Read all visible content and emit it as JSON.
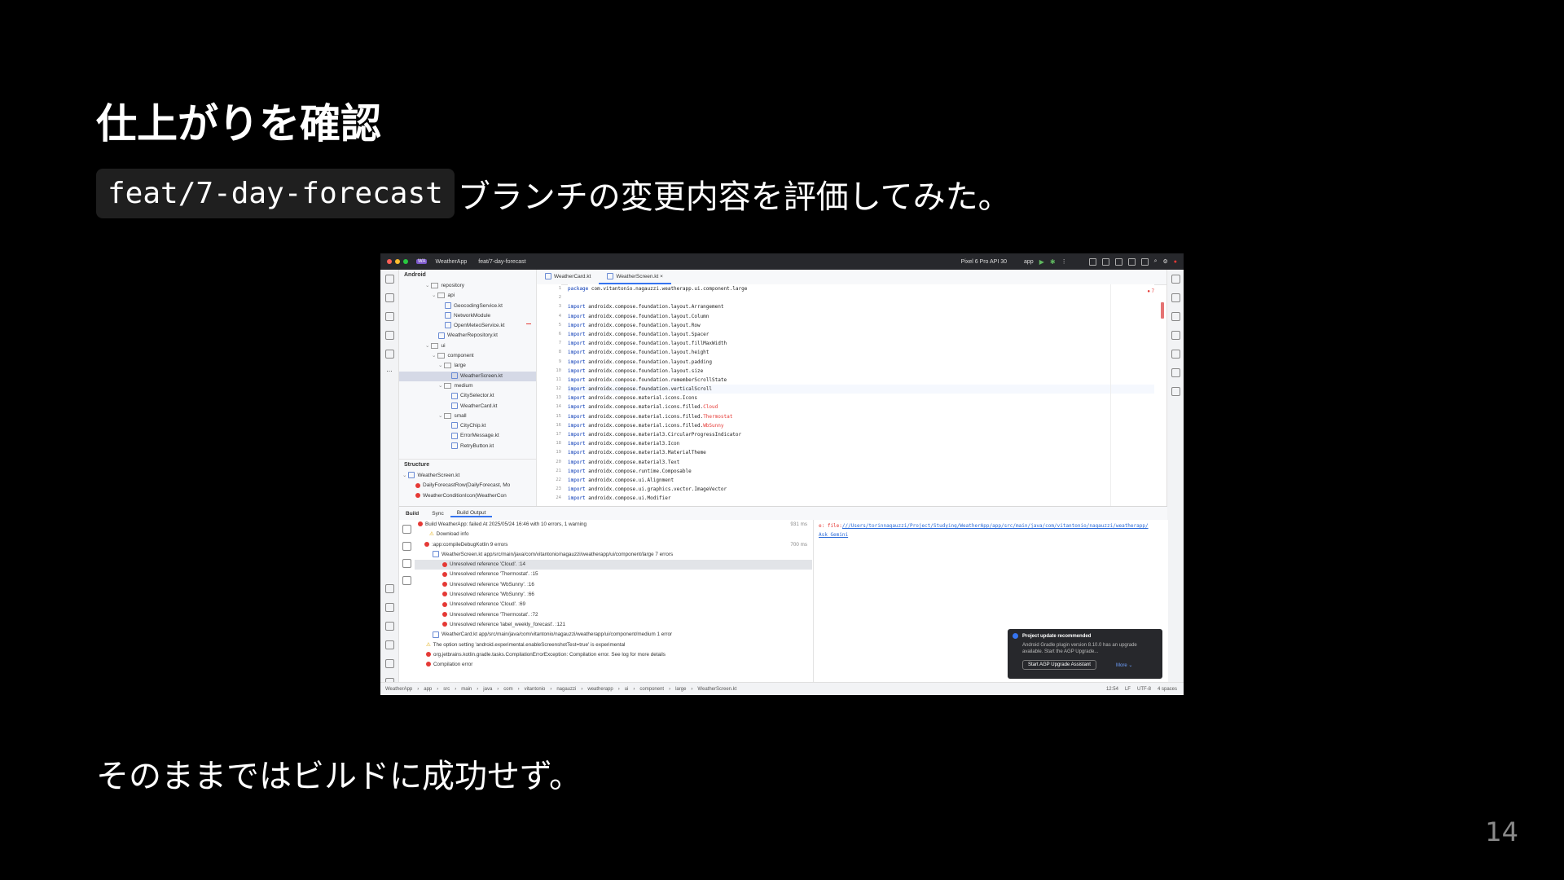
{
  "slide": {
    "title": "仕上がりを確認",
    "branch": "feat/7-day-forecast",
    "subtitle_rest": "ブランチの変更内容を評価してみた。",
    "bottom_text": "そのままではビルドに成功せず。",
    "page_number": "14"
  },
  "ide": {
    "titlebar": {
      "project_badge": "WA",
      "project": "WeatherApp",
      "branch": "feat/7-day-forecast",
      "device": "Pixel 6 Pro API 30",
      "run_config": "app"
    },
    "project_panel": {
      "header": "Android",
      "items": [
        {
          "label": "repository",
          "type": "folder"
        },
        {
          "label": "api",
          "type": "folder"
        },
        {
          "label": "GeocodingService.kt",
          "type": "file"
        },
        {
          "label": "NetworkModule",
          "type": "file"
        },
        {
          "label": "OpenMeteoService.kt",
          "type": "file"
        },
        {
          "label": "WeatherRepository.kt",
          "type": "file"
        },
        {
          "label": "ui",
          "type": "folder"
        },
        {
          "label": "component",
          "type": "folder"
        },
        {
          "label": "large",
          "type": "folder"
        },
        {
          "label": "WeatherScreen.kt",
          "type": "file"
        },
        {
          "label": "medium",
          "type": "folder"
        },
        {
          "label": "CitySelector.kt",
          "type": "file"
        },
        {
          "label": "WeatherCard.kt",
          "type": "file"
        },
        {
          "label": "small",
          "type": "folder"
        },
        {
          "label": "CityChip.kt",
          "type": "file"
        },
        {
          "label": "ErrorMessage.kt",
          "type": "file"
        },
        {
          "label": "RetryButton.kt",
          "type": "file"
        }
      ]
    },
    "structure": {
      "header": "Structure",
      "items": [
        "WeatherScreen.kt",
        "DailyForecastRow(DailyForecast, Mo",
        "WeatherConditionIcon(WeatherCon"
      ]
    },
    "editor": {
      "tabs": [
        "WeatherCard.kt",
        "WeatherScreen.kt"
      ],
      "error_count": "7",
      "lines": [
        {
          "n": "1",
          "kw": "package",
          "rest": " com.vitantonio.nagauzzi.weatherapp.ui.component.large"
        },
        {
          "n": "2",
          "kw": "",
          "rest": ""
        },
        {
          "n": "3",
          "kw": "import",
          "rest": " androidx.compose.foundation.layout.Arrangement"
        },
        {
          "n": "4",
          "kw": "import",
          "rest": " androidx.compose.foundation.layout.Column"
        },
        {
          "n": "5",
          "kw": "import",
          "rest": " androidx.compose.foundation.layout.Row"
        },
        {
          "n": "6",
          "kw": "import",
          "rest": " androidx.compose.foundation.layout.Spacer"
        },
        {
          "n": "7",
          "kw": "import",
          "rest": " androidx.compose.foundation.layout.fillMaxWidth"
        },
        {
          "n": "8",
          "kw": "import",
          "rest": " androidx.compose.foundation.layout.height"
        },
        {
          "n": "9",
          "kw": "import",
          "rest": " androidx.compose.foundation.layout.padding"
        },
        {
          "n": "10",
          "kw": "import",
          "rest": " androidx.compose.foundation.layout.size"
        },
        {
          "n": "11",
          "kw": "import",
          "rest": " androidx.compose.foundation.rememberScrollState"
        },
        {
          "n": "12",
          "kw": "import",
          "rest": " androidx.compose.foundation.verticalScroll"
        },
        {
          "n": "13",
          "kw": "import",
          "rest": " androidx.compose.material.icons.Icons"
        },
        {
          "n": "14",
          "kw": "import",
          "rest": " androidx.compose.material.icons.filled.",
          "err": "Cloud"
        },
        {
          "n": "15",
          "kw": "import",
          "rest": " androidx.compose.material.icons.filled.",
          "err": "Thermostat"
        },
        {
          "n": "16",
          "kw": "import",
          "rest": " androidx.compose.material.icons.filled.",
          "err": "WbSunny"
        },
        {
          "n": "17",
          "kw": "import",
          "rest": " androidx.compose.material3.CircularProgressIndicator"
        },
        {
          "n": "18",
          "kw": "import",
          "rest": " androidx.compose.material3.Icon"
        },
        {
          "n": "19",
          "kw": "import",
          "rest": " androidx.compose.material3.MaterialTheme"
        },
        {
          "n": "20",
          "kw": "import",
          "rest": " androidx.compose.material3.Text"
        },
        {
          "n": "21",
          "kw": "import",
          "rest": " androidx.compose.runtime.Composable"
        },
        {
          "n": "22",
          "kw": "import",
          "rest": " androidx.compose.ui.Alignment"
        },
        {
          "n": "23",
          "kw": "import",
          "rest": " androidx.compose.ui.graphics.vector.ImageVector"
        },
        {
          "n": "24",
          "kw": "import",
          "rest": " androidx.compose.ui.Modifier"
        }
      ]
    },
    "bottom_tabs": [
      "Build",
      "Sync",
      "Build Output"
    ],
    "build_tree": [
      {
        "text": "Build WeatherApp: failed At 2025/05/24 16:46 with 10 errors, 1 warning",
        "icon": "error",
        "time": "931 ms"
      },
      {
        "text": "Download info",
        "icon": "warning",
        "time": ""
      },
      {
        "text": ":app:compileDebugKotlin 9 errors",
        "icon": "error",
        "time": "700 ms"
      },
      {
        "text": "WeatherScreen.kt app/src/main/java/com/vitantonio/nagauzzi/weatherapp/ui/component/large 7 errors",
        "icon": "file",
        "time": ""
      },
      {
        "text": "Unresolved reference 'Cloud'. :14",
        "icon": "error",
        "time": ""
      },
      {
        "text": "Unresolved reference 'Thermostat'. :15",
        "icon": "error",
        "time": ""
      },
      {
        "text": "Unresolved reference 'WbSunny'. :16",
        "icon": "error",
        "time": ""
      },
      {
        "text": "Unresolved reference 'WbSunny'. :66",
        "icon": "error",
        "time": ""
      },
      {
        "text": "Unresolved reference 'Cloud'. :69",
        "icon": "error",
        "time": ""
      },
      {
        "text": "Unresolved reference 'Thermostat'. :72",
        "icon": "error",
        "time": ""
      },
      {
        "text": "Unresolved reference 'label_weekly_forecast'. :121",
        "icon": "error",
        "time": ""
      },
      {
        "text": "WeatherCard.kt app/src/main/java/com/vitantonio/nagauzzi/weatherapp/ui/component/medium 1 error",
        "icon": "file",
        "time": ""
      },
      {
        "text": "The option setting 'android.experimental.enableScreenshotTest=true' is experimental",
        "icon": "warning",
        "time": ""
      },
      {
        "text": "org.jetbrains.kotlin.gradle.tasks.CompilationErrorException: Compilation error. See log for more details",
        "icon": "error",
        "time": ""
      },
      {
        "text": "Compilation error",
        "icon": "error",
        "time": ""
      }
    ],
    "console": {
      "line1_prefix": "e: file:",
      "line1_link": "///Users/torinnagauzzi/Project/Studying/WeatherApp/app/src/main/java/com/vitantonio/nagauzzi/weatherapp/",
      "line2": "Ask Gemini"
    },
    "notification": {
      "title": "Project update recommended",
      "body": "Android Gradle plugin version 8.10.0 has an upgrade available. Start the AGP Upgrade...",
      "button": "Start AGP Upgrade Assistant",
      "more": "More"
    },
    "statusbar": {
      "breadcrumbs": [
        "WeatherApp",
        "app",
        "src",
        "main",
        "java",
        "com",
        "vitantonio",
        "nagauzzi",
        "weatherapp",
        "ui",
        "component",
        "large",
        "WeatherScreen.kt"
      ],
      "position": "12:54",
      "line_sep": "LF",
      "encoding": "UTF-8",
      "indent": "4 spaces"
    }
  }
}
